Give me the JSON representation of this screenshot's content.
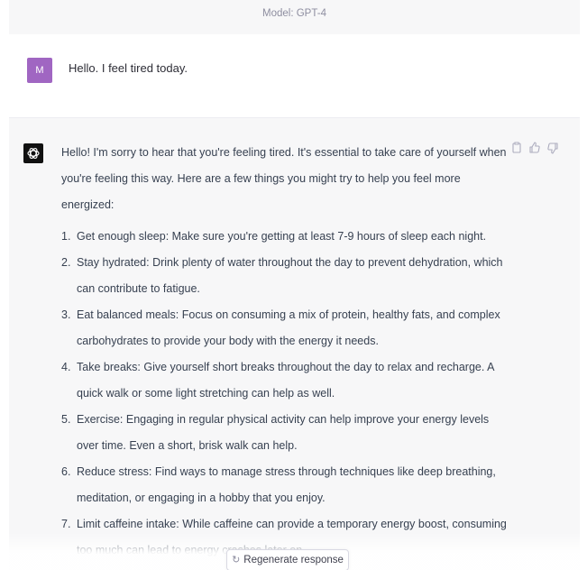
{
  "header": {
    "model_label": "Model: GPT-4"
  },
  "user_message": {
    "avatar_letter": "M",
    "text": "Hello. I feel tired today."
  },
  "assistant_message": {
    "intro": "Hello! I'm sorry to hear that you're feeling tired. It's essential to take care of yourself when you're feeling this way. Here are a few things you might try to help you feel more energized:",
    "items": [
      {
        "num": "1.",
        "text": "Get enough sleep: Make sure you're getting at least 7-9 hours of sleep each night."
      },
      {
        "num": "2.",
        "text": "Stay hydrated: Drink plenty of water throughout the day to prevent dehydration, which can contribute to fatigue."
      },
      {
        "num": "3.",
        "text": "Eat balanced meals: Focus on consuming a mix of protein, healthy fats, and complex carbohydrates to provide your body with the energy it needs."
      },
      {
        "num": "4.",
        "text": "Take breaks: Give yourself short breaks throughout the day to relax and recharge. A quick walk or some light stretching can help as well."
      },
      {
        "num": "5.",
        "text": "Exercise: Engaging in regular physical activity can help improve your energy levels over time. Even a short, brisk walk can help."
      },
      {
        "num": "6.",
        "text": "Reduce stress: Find ways to manage stress through techniques like deep breathing, meditation, or engaging in a hobby that you enjoy."
      },
      {
        "num": "7.",
        "text": "Limit caffeine intake: While caffeine can provide a temporary energy boost, consuming too much can lead to energy crashes later on."
      }
    ]
  },
  "footer": {
    "regenerate_label": "Regenerate response"
  },
  "colors": {
    "user_avatar": "#a066c2",
    "assistant_avatar": "#111111",
    "assistant_bg": "#f7f7f8"
  },
  "icons": [
    "openai-logo-icon",
    "copy-icon",
    "thumbs-up-icon",
    "thumbs-down-icon",
    "refresh-icon"
  ]
}
